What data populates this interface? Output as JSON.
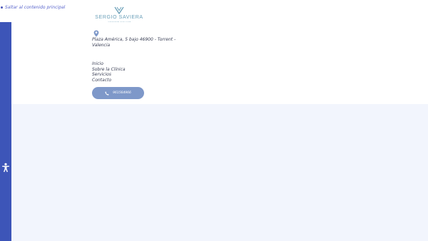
{
  "skip_link": {
    "label": "Saltar al contenido principal"
  },
  "accessibility": {
    "icon": "accessibility-icon"
  },
  "brand": {
    "name": "SERGIO SAVIERA",
    "tagline": "CLÍNICA DENTAL ODONTOLOGÍA",
    "colors": {
      "logo": "#6a9fb8",
      "accent": "#3d55b8"
    }
  },
  "contact": {
    "location_icon": "map-pin-icon",
    "address": "Plaza América, 5 bajo 46900 - Torrent - Valencia",
    "phone_icon": "phone-icon",
    "phone": "961564966"
  },
  "nav": {
    "items": [
      {
        "label": "Inicio"
      },
      {
        "label": "Sobre la Clínica"
      },
      {
        "label": "Servicios"
      },
      {
        "label": "Contacto"
      }
    ]
  },
  "colors": {
    "page_lower_bg": "#f2f5fd",
    "accessibility_bar": "#3d55b8",
    "phone_button": "#7e98c9",
    "skip_link": "#5a66cc"
  }
}
